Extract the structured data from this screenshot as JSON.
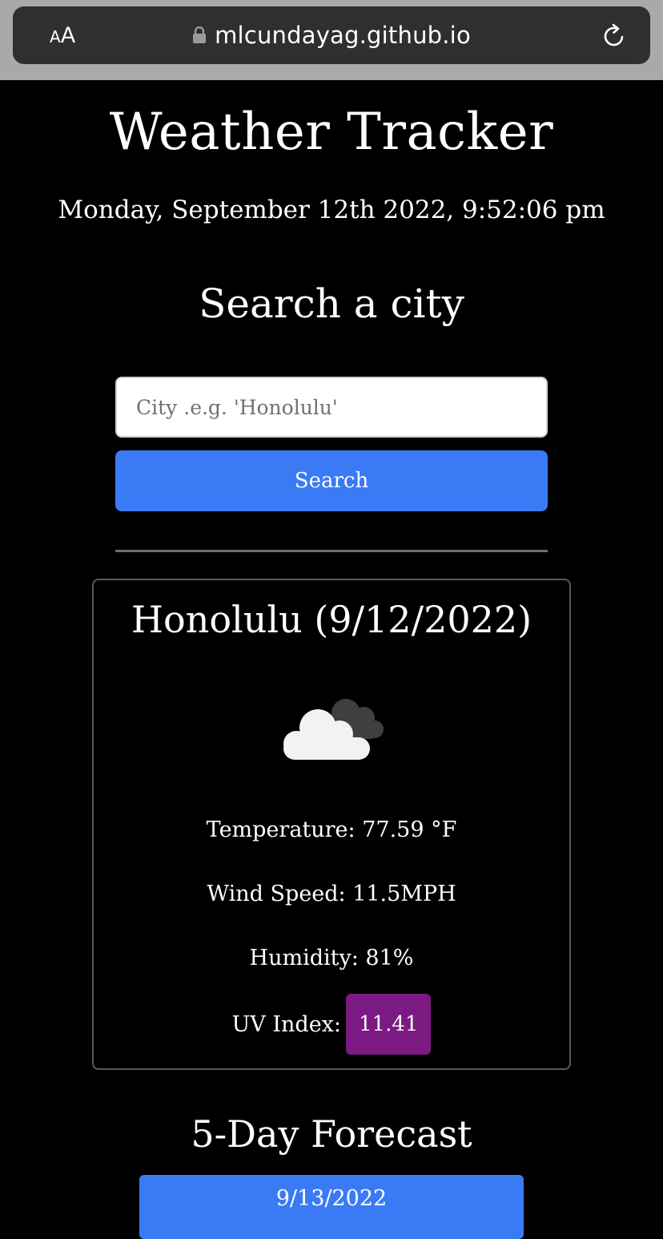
{
  "browser": {
    "aa_small": "A",
    "aa_big": "A",
    "url": "mlcundayag.github.io",
    "icons": [
      "lock-icon",
      "reload-icon"
    ]
  },
  "header": {
    "title": "Weather Tracker",
    "datetime": "Monday, September 12th 2022, 9:52:06 pm"
  },
  "search": {
    "heading": "Search a city",
    "placeholder": "City .e.g. 'Honolulu'",
    "value": "",
    "button_label": "Search"
  },
  "current": {
    "title": "Honolulu (9/12/2022)",
    "icon": "cloudy-icon",
    "temperature": "Temperature: 77.59 °F",
    "wind": "Wind Speed: 11.5MPH",
    "humidity": "Humidity: 81%",
    "uv_label": "UV Index:",
    "uv_value": "11.41",
    "uv_color": "#7a1a82"
  },
  "forecast": {
    "heading": "5-Day Forecast",
    "days": [
      {
        "date": "9/13/2022"
      }
    ]
  },
  "colors": {
    "background": "#000000",
    "accent": "#3a7bf5",
    "browser_chrome": "#a9a9a9"
  }
}
